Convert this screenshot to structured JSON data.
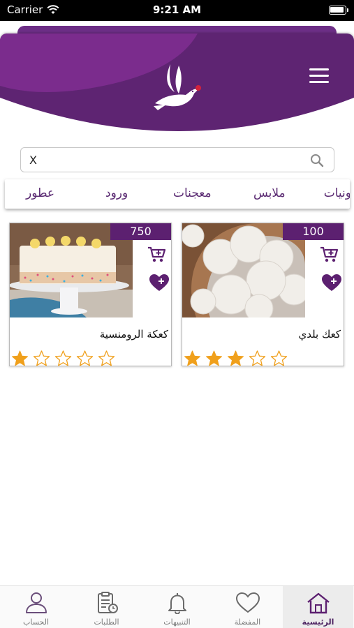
{
  "status_bar": {
    "carrier": "Carrier",
    "time": "9:21 AM"
  },
  "colors": {
    "brand_purple": "#6d2e86",
    "price_bg": "#5c2070",
    "star_filled": "#f0a01c",
    "star_empty": "#f0a01c"
  },
  "header": {
    "menu_icon": "hamburger-menu-icon",
    "logo_icon": "dove-logo-icon"
  },
  "search": {
    "value": "X",
    "icon": "search-icon"
  },
  "categories": [
    "ونيات",
    "ملابس",
    "معجنات",
    "ورود",
    "عطور"
  ],
  "products": [
    {
      "name": "كعك بلدي",
      "price": "100",
      "rating": 3,
      "max_rating": 5,
      "image": "powdered-cookies-photo"
    },
    {
      "name": "كعكة الرومنسية",
      "price": "750",
      "rating": 1,
      "max_rating": 5,
      "image": "sprinkle-cake-photo"
    }
  ],
  "tabbar": {
    "tabs": [
      {
        "label": "الرئيسية",
        "icon": "home-icon",
        "active": true
      },
      {
        "label": "المفضلة",
        "icon": "heart-icon",
        "active": false
      },
      {
        "label": "التنبيهات",
        "icon": "bell-icon",
        "active": false
      },
      {
        "label": "الطلبات",
        "icon": "orders-clipboard-icon",
        "active": false
      },
      {
        "label": "الحساب",
        "icon": "user-icon",
        "active": false
      }
    ]
  }
}
